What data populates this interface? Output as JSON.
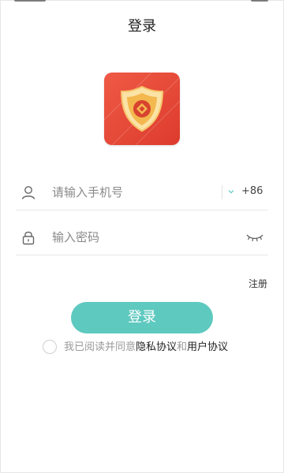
{
  "header": {
    "title": "登录"
  },
  "phone": {
    "placeholder": "请输入手机号",
    "country_code": "+86"
  },
  "password": {
    "placeholder": "输入密码"
  },
  "register_label": "注册",
  "login_button_label": "登录",
  "agreement": {
    "prefix": "我已阅读并同意",
    "privacy_label": "隐私协议",
    "and_text": "和",
    "terms_label": "用户协议",
    "checked": false
  },
  "colors": {
    "accent": "#5ec9bf",
    "logo": "#e2473a"
  },
  "icons": [
    "user-icon",
    "chevron-down-icon",
    "lock-icon",
    "eye-closed-icon",
    "app-logo"
  ]
}
